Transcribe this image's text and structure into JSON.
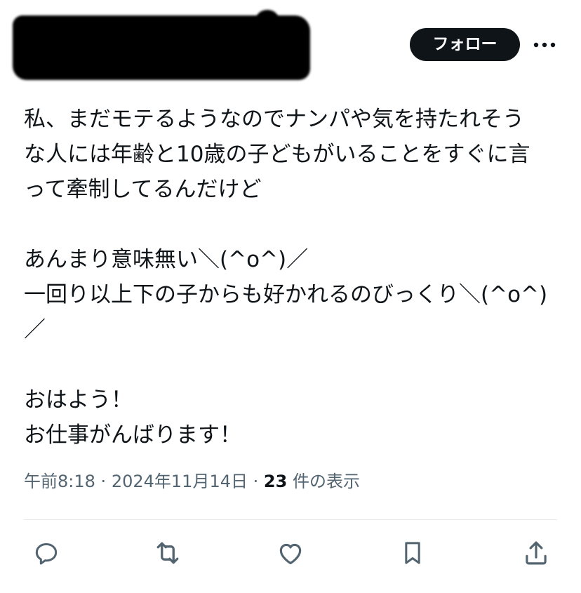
{
  "header": {
    "follow_label": "フォロー",
    "more_icon": "more-horizontal-icon"
  },
  "tweet": {
    "text": "私、まだモテるようなのでナンパや気を持たれそう\nな人には年齢と10歳の子どもがいることをすぐに言\nって牽制してるんだけど\n\nあんまり意味無い＼(^o^)／\n一回り以上下の子からも好かれるのびっくり＼(^o^)\n／\n\nおはよう！\nお仕事がんばります！",
    "time": "午前8:18",
    "date": "2024年11月14日",
    "separator": "·",
    "views_count": "23",
    "views_label": "件の表示"
  },
  "actions": [
    {
      "icon": "reply-icon"
    },
    {
      "icon": "retweet-icon"
    },
    {
      "icon": "like-icon"
    },
    {
      "icon": "bookmark-icon"
    },
    {
      "icon": "share-icon"
    }
  ],
  "colors": {
    "text": "#0f1419",
    "secondary": "#536471",
    "button_bg": "#0f1419",
    "icon": "#536471"
  }
}
